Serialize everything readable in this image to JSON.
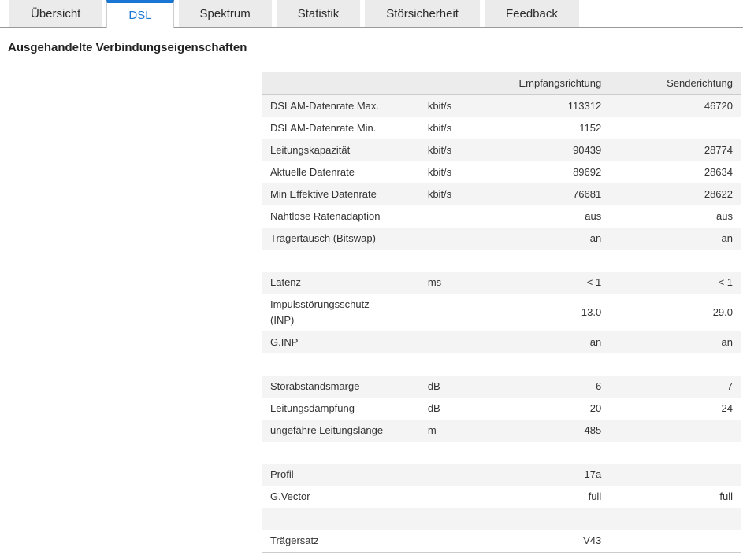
{
  "tabs": [
    {
      "label": "Übersicht",
      "active": false
    },
    {
      "label": "DSL",
      "active": true
    },
    {
      "label": "Spektrum",
      "active": false
    },
    {
      "label": "Statistik",
      "active": false
    },
    {
      "label": "Störsicherheit",
      "active": false
    },
    {
      "label": "Feedback",
      "active": false
    }
  ],
  "heading": "Ausgehandelte Verbindungseigenschaften",
  "table": {
    "col_rx": "Empfangsrichtung",
    "col_tx": "Senderichtung",
    "rows": [
      {
        "label": "DSLAM-Datenrate Max.",
        "unit": "kbit/s",
        "rx": "113312",
        "tx": "46720"
      },
      {
        "label": "DSLAM-Datenrate Min.",
        "unit": "kbit/s",
        "rx": "1152",
        "tx": ""
      },
      {
        "label": "Leitungskapazität",
        "unit": "kbit/s",
        "rx": "90439",
        "tx": "28774"
      },
      {
        "label": "Aktuelle Datenrate",
        "unit": "kbit/s",
        "rx": "89692",
        "tx": "28634"
      },
      {
        "label": "Min Effektive Datenrate",
        "unit": "kbit/s",
        "rx": "76681",
        "tx": "28622"
      },
      {
        "label": "Nahtlose Ratenadaption",
        "unit": "",
        "rx": "aus",
        "tx": "aus"
      },
      {
        "label": "Trägertausch (Bitswap)",
        "unit": "",
        "rx": "an",
        "tx": "an"
      },
      {
        "label": "",
        "unit": "",
        "rx": "",
        "tx": ""
      },
      {
        "label": "Latenz",
        "unit": "ms",
        "rx": "< 1",
        "tx": "< 1"
      },
      {
        "label": "Impulsstörungsschutz\n(INP)",
        "unit": "",
        "rx": "13.0",
        "tx": "29.0"
      },
      {
        "label": "G.INP",
        "unit": "",
        "rx": "an",
        "tx": "an"
      },
      {
        "label": "",
        "unit": "",
        "rx": "",
        "tx": ""
      },
      {
        "label": "Störabstandsmarge",
        "unit": "dB",
        "rx": "6",
        "tx": "7"
      },
      {
        "label": "Leitungsdämpfung",
        "unit": "dB",
        "rx": "20",
        "tx": "24"
      },
      {
        "label": "ungefähre Leitungslänge",
        "unit": "m",
        "rx": "485",
        "tx": ""
      },
      {
        "label": "",
        "unit": "",
        "rx": "",
        "tx": ""
      },
      {
        "label": "Profil",
        "unit": "",
        "rx": "17a",
        "tx": ""
      },
      {
        "label": "G.Vector",
        "unit": "",
        "rx": "full",
        "tx": "full"
      },
      {
        "label": "",
        "unit": "",
        "rx": "",
        "tx": ""
      },
      {
        "label": "Trägersatz",
        "unit": "",
        "rx": "V43",
        "tx": ""
      }
    ]
  },
  "colors": {
    "accent": "#1976d2",
    "tabbg": "#ebebeb",
    "tabline": "#999999",
    "border": "#cccccc",
    "headbg": "#ececec",
    "zebra": "#f4f4f4",
    "text": "#333333"
  }
}
